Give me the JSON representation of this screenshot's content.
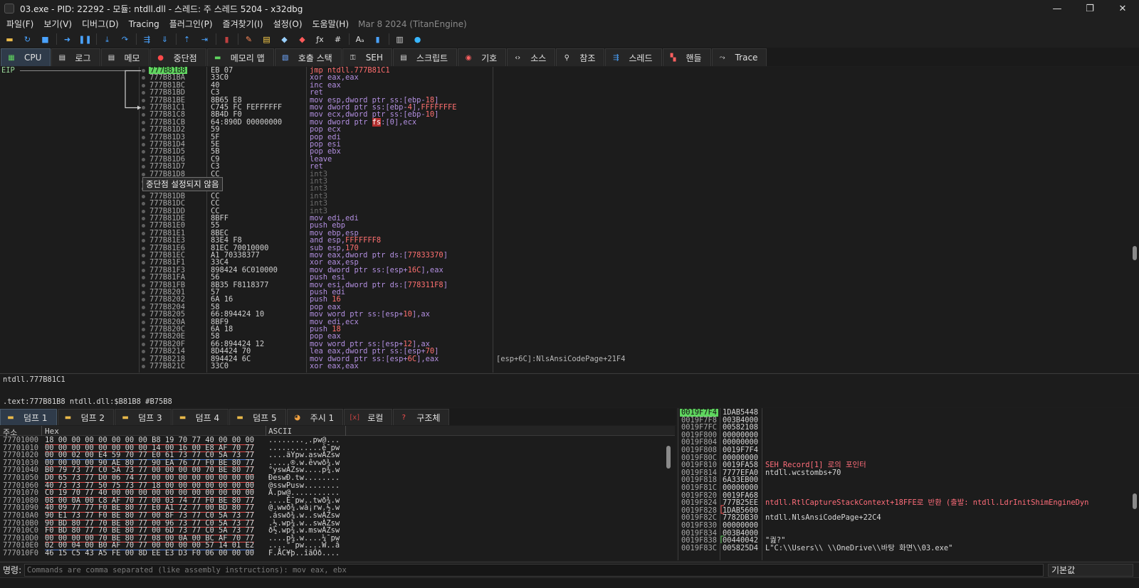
{
  "window": {
    "title": "03.exe - PID: 22292 - 모듈: ntdll.dll - 스레드: 주 스레드 5204 - x32dbg",
    "minimize": "—",
    "maximize": "❐",
    "close": "✕"
  },
  "menu": {
    "items": [
      "파일(F)",
      "보기(V)",
      "디버그(D)",
      "Tracing",
      "플러그인(P)",
      "즐겨찾기(I)",
      "설정(O)",
      "도움말(H)"
    ],
    "date": "Mar 8 2024 (TitanEngine)"
  },
  "toolbar": {
    "buttons": [
      {
        "name": "open-icon",
        "glyph": "▬",
        "color": "#e8b84a"
      },
      {
        "name": "restart-icon",
        "glyph": "↻",
        "color": "#4aa3ff"
      },
      {
        "name": "stop-icon",
        "glyph": "■",
        "color": "#4aa3ff"
      },
      {
        "name": "sep"
      },
      {
        "name": "run-icon",
        "glyph": "➜",
        "color": "#4aa3ff"
      },
      {
        "name": "pause-icon",
        "glyph": "❚❚",
        "color": "#4aa3ff"
      },
      {
        "name": "sep"
      },
      {
        "name": "step-into-icon",
        "glyph": "⤓",
        "color": "#4aa3ff"
      },
      {
        "name": "step-over-icon",
        "glyph": "↷",
        "color": "#4aa3ff"
      },
      {
        "name": "sep"
      },
      {
        "name": "trace-into-icon",
        "glyph": "⇶",
        "color": "#4aa3ff"
      },
      {
        "name": "trace-over-icon",
        "glyph": "⇓",
        "color": "#4aa3ff"
      },
      {
        "name": "sep"
      },
      {
        "name": "execute-till-return-icon",
        "glyph": "⇡",
        "color": "#4aa3ff"
      },
      {
        "name": "run-to-user-code-icon",
        "glyph": "⇥",
        "color": "#4aa3ff"
      },
      {
        "name": "sep"
      },
      {
        "name": "scylla-icon",
        "glyph": "▮",
        "color": "#c04040"
      },
      {
        "name": "sep"
      },
      {
        "name": "patch-icon",
        "glyph": "✎",
        "color": "#ff8a5a"
      },
      {
        "name": "comment-icon",
        "glyph": "▤",
        "color": "#ffd14a"
      },
      {
        "name": "label-icon",
        "glyph": "◆",
        "color": "#9ad0ff"
      },
      {
        "name": "bookmark-icon",
        "glyph": "◆",
        "color": "#ff5a5a"
      },
      {
        "name": "function-icon",
        "glyph": "ƒx",
        "color": "#e0e0e0"
      },
      {
        "name": "hash-icon",
        "glyph": "#",
        "color": "#e0e0e0"
      },
      {
        "name": "sep"
      },
      {
        "name": "strings-icon",
        "glyph": "Aₐ",
        "color": "#e0e0e0"
      },
      {
        "name": "calls-icon",
        "glyph": "▮",
        "color": "#4aa3ff"
      },
      {
        "name": "sep"
      },
      {
        "name": "log-icon",
        "glyph": "▥",
        "color": "#d0d0d0"
      },
      {
        "name": "globe-icon",
        "glyph": "●",
        "color": "#38b6ff"
      }
    ]
  },
  "tabs": [
    {
      "label": "CPU",
      "icon": "cpu-icon",
      "glyph": "▦",
      "color": "#5fd55f",
      "active": true
    },
    {
      "label": "로그",
      "icon": "log-icon",
      "glyph": "▤",
      "color": "#e0e0e0"
    },
    {
      "label": "메모",
      "icon": "notes-icon",
      "glyph": "▤",
      "color": "#e0e0e0"
    },
    {
      "label": "중단점",
      "icon": "breakpoint-icon",
      "glyph": "●",
      "color": "#ff4a4a"
    },
    {
      "label": "메모리 맵",
      "icon": "memory-map-icon",
      "glyph": "▬",
      "color": "#5fd55f"
    },
    {
      "label": "호출 스택",
      "icon": "call-stack-icon",
      "glyph": "▧",
      "color": "#6fa8ff"
    },
    {
      "label": "SEH",
      "icon": "seh-icon",
      "glyph": "⚿",
      "color": "#e0e0e0"
    },
    {
      "label": "스크립트",
      "icon": "script-icon",
      "glyph": "▤",
      "color": "#e0e0e0"
    },
    {
      "label": "기호",
      "icon": "symbols-icon",
      "glyph": "◉",
      "color": "#ff6060"
    },
    {
      "label": "소스",
      "icon": "source-icon",
      "glyph": "‹›",
      "color": "#e0e0e0"
    },
    {
      "label": "참조",
      "icon": "references-icon",
      "glyph": "⚲",
      "color": "#e0e0e0"
    },
    {
      "label": "스레드",
      "icon": "threads-icon",
      "glyph": "⇶",
      "color": "#4aa3ff"
    },
    {
      "label": "핸들",
      "icon": "handles-icon",
      "glyph": "▚",
      "color": "#ff6060"
    },
    {
      "label": "Trace",
      "icon": "trace-icon",
      "glyph": "⤳",
      "color": "#e0e0e0"
    }
  ],
  "cpu": {
    "eip_label": "EIP",
    "tooltip": "중단점 설정되지 않음",
    "rows": [
      {
        "addr": "777B81B8",
        "bytes": "EB 07",
        "instr": "jmp ntdll.777B81C1",
        "kind": "jmp",
        "current": true
      },
      {
        "addr": "777B81BA",
        "bytes": "33C0",
        "instr": "xor eax,eax"
      },
      {
        "addr": "777B81BC",
        "bytes": "40",
        "instr": "inc eax"
      },
      {
        "addr": "777B81BD",
        "bytes": "C3",
        "instr": "ret"
      },
      {
        "addr": "777B81BE",
        "bytes": "8B65 E8",
        "instr": "mov esp,dword ptr ss:[ebp-18]"
      },
      {
        "addr": "777B81C1",
        "bytes": "C745 FC FEFFFFFF",
        "instr": "mov dword ptr ss:[ebp-4],FFFFFFFE"
      },
      {
        "addr": "777B81C8",
        "bytes": "8B4D F0",
        "instr": "mov ecx,dword ptr ss:[ebp-10]"
      },
      {
        "addr": "777B81CB",
        "bytes": "64:890D 00000000",
        "instr": "mov dword ptr fs:[0],ecx",
        "seg": true
      },
      {
        "addr": "777B81D2",
        "bytes": "59",
        "instr": "pop ecx"
      },
      {
        "addr": "777B81D3",
        "bytes": "5F",
        "instr": "pop edi"
      },
      {
        "addr": "777B81D4",
        "bytes": "5E",
        "instr": "pop esi"
      },
      {
        "addr": "777B81D5",
        "bytes": "5B",
        "instr": "pop ebx"
      },
      {
        "addr": "777B81D6",
        "bytes": "C9",
        "instr": "leave"
      },
      {
        "addr": "777B81D7",
        "bytes": "C3",
        "instr": "ret"
      },
      {
        "addr": "777B81D8",
        "bytes": "CC",
        "instr": "int3",
        "kind": "nop"
      },
      {
        "addr": "777B81D9",
        "bytes": "CC",
        "instr": "int3",
        "kind": "nop"
      },
      {
        "addr": "777B81DA",
        "bytes": "CC",
        "instr": "int3",
        "kind": "nop"
      },
      {
        "addr": "777B81DB",
        "bytes": "CC",
        "instr": "int3",
        "kind": "nop"
      },
      {
        "addr": "777B81DC",
        "bytes": "CC",
        "instr": "int3",
        "kind": "nop"
      },
      {
        "addr": "777B81DD",
        "bytes": "CC",
        "instr": "int3",
        "kind": "nop"
      },
      {
        "addr": "777B81DE",
        "bytes": "8BFF",
        "instr": "mov edi,edi"
      },
      {
        "addr": "777B81E0",
        "bytes": "55",
        "instr": "push ebp"
      },
      {
        "addr": "777B81E1",
        "bytes": "8BEC",
        "instr": "mov ebp,esp"
      },
      {
        "addr": "777B81E3",
        "bytes": "83E4 F8",
        "instr": "and esp,FFFFFFF8"
      },
      {
        "addr": "777B81E6",
        "bytes": "81EC 70010000",
        "instr": "sub esp,170"
      },
      {
        "addr": "777B81EC",
        "bytes": "A1 70338377",
        "instr": "mov eax,dword ptr ds:[77833370]"
      },
      {
        "addr": "777B81F1",
        "bytes": "33C4",
        "instr": "xor eax,esp"
      },
      {
        "addr": "777B81F3",
        "bytes": "898424 6C010000",
        "instr": "mov dword ptr ss:[esp+16C],eax"
      },
      {
        "addr": "777B81FA",
        "bytes": "56",
        "instr": "push esi"
      },
      {
        "addr": "777B81FB",
        "bytes": "8B35 F8118377",
        "instr": "mov esi,dword ptr ds:[778311F8]"
      },
      {
        "addr": "777B8201",
        "bytes": "57",
        "instr": "push edi"
      },
      {
        "addr": "777B8202",
        "bytes": "6A 16",
        "instr": "push 16"
      },
      {
        "addr": "777B8204",
        "bytes": "58",
        "instr": "pop eax"
      },
      {
        "addr": "777B8205",
        "bytes": "66:894424 10",
        "instr": "mov word ptr ss:[esp+10],ax"
      },
      {
        "addr": "777B820A",
        "bytes": "8BF9",
        "instr": "mov edi,ecx"
      },
      {
        "addr": "777B820C",
        "bytes": "6A 18",
        "instr": "push 18"
      },
      {
        "addr": "777B820E",
        "bytes": "58",
        "instr": "pop eax"
      },
      {
        "addr": "777B820F",
        "bytes": "66:894424 12",
        "instr": "mov word ptr ss:[esp+12],ax"
      },
      {
        "addr": "777B8214",
        "bytes": "8D4424 70",
        "instr": "lea eax,dword ptr ss:[esp+70]"
      },
      {
        "addr": "777B8218",
        "bytes": "894424 6C",
        "instr": "mov dword ptr ss:[esp+6C],eax",
        "comment": "[esp+6C]:NlsAnsiCodePage+21F4"
      },
      {
        "addr": "777B821C",
        "bytes": "33C0",
        "instr": "xor eax,eax"
      }
    ]
  },
  "info": {
    "line1": "ntdll.777B81C1",
    "line2": ".text:777B81B8 ntdll.dll:$B81B8 #B75B8"
  },
  "dump_tabs": [
    {
      "label": "덤프 1",
      "icon": "dump-icon",
      "glyph": "▬",
      "color": "#e8b84a",
      "active": true
    },
    {
      "label": "덤프 2",
      "icon": "dump-icon",
      "glyph": "▬",
      "color": "#e8b84a"
    },
    {
      "label": "덤프 3",
      "icon": "dump-icon",
      "glyph": "▬",
      "color": "#e8b84a"
    },
    {
      "label": "덤프 4",
      "icon": "dump-icon",
      "glyph": "▬",
      "color": "#e8b84a"
    },
    {
      "label": "덤프 5",
      "icon": "dump-icon",
      "glyph": "▬",
      "color": "#e8b84a"
    },
    {
      "label": "주시 1",
      "icon": "watch-icon",
      "glyph": "◕",
      "color": "#f0a040"
    },
    {
      "label": "로컬",
      "icon": "locals-icon",
      "glyph": "[x]",
      "color": "#c04040"
    },
    {
      "label": "구조체",
      "icon": "struct-icon",
      "glyph": "?",
      "color": "#ff5050"
    }
  ],
  "dump": {
    "headers": [
      "주소",
      "Hex",
      "ASCII"
    ],
    "rows": [
      {
        "addr": "77701000",
        "hex": "18 00 00 00 00 00 00 00 B8 19 70 77 40 00 00 00",
        "ascii": "........¸.pw@...",
        "ul": "r"
      },
      {
        "addr": "77701010",
        "hex": "00 00 00 00 00 00 00 00 14 00 16 00 E8 AF 70 77",
        "ascii": "............è¯pw",
        "ul": "r"
      },
      {
        "addr": "77701020",
        "hex": "00 00 02 00 E4 59 70 77 E0 61 73 77 C0 5A 73 77",
        "ascii": "....äYpw.aswÀZsw",
        "ul": "b"
      },
      {
        "addr": "77701030",
        "hex": "00 00 00 00 90 AE 80 77 90 EA 76 77 F0 BE 80 77",
        "ascii": ".....®.w.êvwð¾.w",
        "ul": "r"
      },
      {
        "addr": "77701040",
        "hex": "B0 79 73 77 C0 5A 73 77 00 00 00 00 70 BE 80 77",
        "ascii": "°yswÀZsw....p¾.w",
        "ul": "r"
      },
      {
        "addr": "77701050",
        "hex": "D0 65 73 77 D0 06 74 77 00 00 00 00 00 00 00 00",
        "ascii": "ÐeswÐ.tw........",
        "ul": "r"
      },
      {
        "addr": "77701060",
        "hex": "40 73 73 77 50 75 73 77 18 00 00 00 00 00 00 00",
        "ascii": "@sswPusw........",
        "ul": "r"
      },
      {
        "addr": "77701070",
        "hex": "C0 19 70 77 40 00 00 00 00 00 00 00 00 00 00 00",
        "ascii": "À.pw@...........",
        "ul": "r"
      },
      {
        "addr": "77701080",
        "hex": "08 00 0A 00 C8 AF 70 77 00 03 74 77 F0 BE 80 77",
        "ascii": "....È¯pw..twð¾.w",
        "ul": "r"
      },
      {
        "addr": "77701090",
        "hex": "40 09 77 77 F0 BE 80 77 E0 A1 72 77 00 BD 80 77",
        "ascii": "@.wwð¾.wà¡rw.½.w",
        "ul": "r"
      },
      {
        "addr": "777010A0",
        "hex": "90 E1 73 77 F0 BE 80 77 00 8F 73 77 C0 5A 73 77",
        "ascii": ".áswð¾.w..swÀZsw",
        "ul": "r"
      },
      {
        "addr": "777010B0",
        "hex": "90 BD 80 77 70 BE 80 77 00 96 73 77 C0 5A 73 77",
        "ascii": ".½.wp¾.w..swÀZsw",
        "ul": "r"
      },
      {
        "addr": "777010C0",
        "hex": "F0 BD 80 77 70 BE 80 77 00 6D 73 77 C0 5A 73 77",
        "ascii": "ð½.wp¾.w.mswÀZsw",
        "ul": "r"
      },
      {
        "addr": "777010D0",
        "hex": "00 00 00 00 70 BE 80 77 08 00 0A 00 BC AF 70 77",
        "ascii": "....p¾.w....¼¯pw",
        "ul": "r"
      },
      {
        "addr": "777010E0",
        "hex": "02 00 04 00 B0 AF 70 77 00 00 00 00 57 14 01 E2",
        "ascii": "....°¯pw....W..â",
        "ul": "b"
      },
      {
        "addr": "777010F0",
        "hex": "46 15 C5 43 A5 FE 00 8D EE E3 D3 F0 06 00 00 00",
        "ascii": "F.ÅC¥þ..îãÓð....",
        "ul": ""
      }
    ]
  },
  "stack": {
    "rows": [
      {
        "addr": "0019F7F4",
        "val": "1DAB5448",
        "cmt": "",
        "current": true
      },
      {
        "addr": "0019F7F8",
        "val": "003B4000",
        "cmt": ""
      },
      {
        "addr": "0019F7FC",
        "val": "00582108",
        "cmt": ""
      },
      {
        "addr": "0019F800",
        "val": "00000000",
        "cmt": ""
      },
      {
        "addr": "0019F804",
        "val": "00000000",
        "cmt": ""
      },
      {
        "addr": "0019F808",
        "val": "0019F7F4",
        "cmt": ""
      },
      {
        "addr": "0019F80C",
        "val": "00000000",
        "cmt": ""
      },
      {
        "addr": "0019F810",
        "val": "0019FA58",
        "cmt": "SEH_Record[1] 로의 포인터",
        "red": true
      },
      {
        "addr": "0019F814",
        "val": "7777EFA0",
        "cmt": "ntdll.wcstombs+70"
      },
      {
        "addr": "0019F818",
        "val": "6A33EB00",
        "cmt": ""
      },
      {
        "addr": "0019F81C",
        "val": "00000000",
        "cmt": ""
      },
      {
        "addr": "0019F820",
        "val": "0019FA68",
        "cmt": ""
      },
      {
        "addr": "0019F824",
        "val": "777B25EE",
        "cmt": "ntdll.RtlCaptureStackContext+18FFE로 반환 (출발: ntdll.LdrInitShimEngineDyn",
        "red": true
      },
      {
        "addr": "0019F828",
        "val": "1DAB5600",
        "cmt": ""
      },
      {
        "addr": "0019F82C",
        "val": "7782DB30",
        "cmt": "ntdll.NlsAnsiCodePage+22C4"
      },
      {
        "addr": "0019F830",
        "val": "00000000",
        "cmt": ""
      },
      {
        "addr": "0019F834",
        "val": "003B4000",
        "cmt": ""
      },
      {
        "addr": "0019F838",
        "val": "00440042",
        "cmt": "\"궖?\""
      },
      {
        "addr": "0019F83C",
        "val": "005825D4",
        "cmt": "L\"C:\\\\Users\\\\ \\\\OneDrive\\\\바탕 화면\\\\03.exe\""
      }
    ]
  },
  "command": {
    "label": "명령:",
    "placeholder": "Commands are comma separated (like assembly instructions): mov eax, ebx",
    "mode": "기본값"
  }
}
